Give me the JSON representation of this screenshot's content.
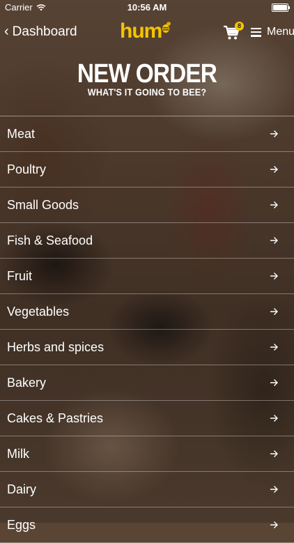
{
  "status_bar": {
    "carrier": "Carrier",
    "time": "10:56 AM"
  },
  "nav": {
    "back_label": "Dashboard",
    "logo_text": "hum",
    "cart_count": "8",
    "menu_label": "Menu"
  },
  "header": {
    "title": "NEW ORDER",
    "subtitle": "WHAT'S IT GOING TO BEE?"
  },
  "categories": [
    {
      "label": "Meat"
    },
    {
      "label": "Poultry"
    },
    {
      "label": "Small Goods"
    },
    {
      "label": "Fish & Seafood"
    },
    {
      "label": "Fruit"
    },
    {
      "label": "Vegetables"
    },
    {
      "label": "Herbs and spices"
    },
    {
      "label": "Bakery"
    },
    {
      "label": "Cakes & Pastries"
    },
    {
      "label": "Milk"
    },
    {
      "label": "Dairy"
    },
    {
      "label": "Eggs"
    }
  ],
  "colors": {
    "brand_yellow": "#f5c400"
  }
}
